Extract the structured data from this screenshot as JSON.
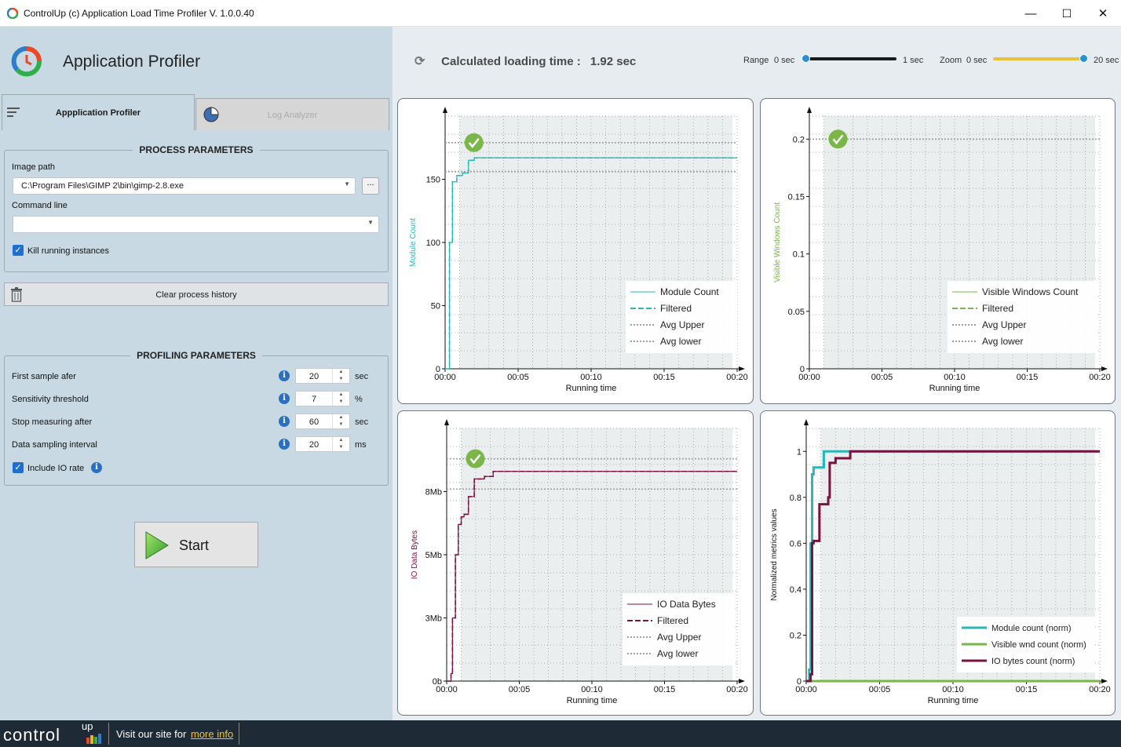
{
  "window": {
    "title": "ControlUp (c) Application Load Time Profiler  V. 1.0.0.40",
    "controls": {
      "minimize": "—",
      "maximize": "☐",
      "close": "✕"
    }
  },
  "header": {
    "app_title": "Application Profiler",
    "calc_label": "Calculated loading time :",
    "calc_value": "1.92 sec",
    "range": {
      "label": "Range",
      "min": "0 sec",
      "max": "1 sec",
      "level": 1.0
    },
    "zoom": {
      "label": "Zoom",
      "min": "0 sec",
      "max": "20 sec",
      "level": 1.0
    }
  },
  "tabs": [
    {
      "label": "Appplication Profiler",
      "active": true
    },
    {
      "label": "Log Analyzer",
      "active": false
    }
  ],
  "process": {
    "title": "PROCESS PARAMETERS",
    "image_path_label": "Image path",
    "image_path_value": "C:\\Program Files\\GIMP 2\\bin\\gimp-2.8.exe",
    "browse_label": "...",
    "cmd_label": "Command line",
    "cmd_value": "",
    "kill_label": "Kill running instances",
    "kill_checked": true
  },
  "clear_label": "Clear process history",
  "profiling": {
    "title": "PROFILING PARAMETERS",
    "rows": [
      {
        "label": "First sample afer",
        "value": "20",
        "unit": "sec"
      },
      {
        "label": "Sensitivity threshold",
        "value": "7",
        "unit": "%"
      },
      {
        "label": "Stop measuring after",
        "value": "60",
        "unit": "sec"
      },
      {
        "label": "Data sampling interval",
        "value": "20",
        "unit": "ms"
      }
    ],
    "io_label": "Include IO rate",
    "io_checked": true
  },
  "start_label": "Start",
  "footer": {
    "brand": "control",
    "brand_up": "up",
    "text": "Visit our site for",
    "link": "more info"
  },
  "colors": {
    "module": "#2ab7b7",
    "visible": "#7ab648",
    "io": "#7a1240",
    "avg": "#a0a0a0",
    "check": "#7ab648",
    "slider_range": "#1a1a1a",
    "slider_zoom": "#e9c23c"
  },
  "chart_data": [
    {
      "type": "line",
      "xlabel": "Running time",
      "ylabel": "Module Count",
      "xticks": [
        "00:00",
        "00:05",
        "00:10",
        "00:15",
        "00:20"
      ],
      "xlim": [
        0,
        20
      ],
      "ylim": [
        0,
        200
      ],
      "yticks": [
        "0",
        "50",
        "100",
        "150"
      ],
      "ytick_values": [
        0,
        50,
        100,
        150
      ],
      "series": [
        {
          "name": "Module Count",
          "style": "solid",
          "color": "#2ab7b7",
          "x": [
            0,
            0.3,
            0.5,
            0.8,
            1.2,
            1.6,
            2.0,
            20
          ],
          "y": [
            0,
            100,
            148,
            153,
            155,
            165,
            167,
            167
          ]
        },
        {
          "name": "Filtered",
          "style": "dashed",
          "color": "#2ab7b7",
          "x": [
            0,
            0.3,
            0.5,
            0.8,
            1.2,
            1.6,
            2.0,
            20
          ],
          "y": [
            0,
            100,
            148,
            153,
            155,
            165,
            167,
            167
          ]
        },
        {
          "name": "Avg Upper",
          "style": "dotted",
          "color": "#a0a0a0",
          "x": [
            0,
            20
          ],
          "y": [
            179,
            179
          ]
        },
        {
          "name": "Avg lower",
          "style": "dotted",
          "color": "#a0a0a0",
          "x": [
            0,
            20
          ],
          "y": [
            156,
            156
          ]
        }
      ],
      "check_x": 1.92
    },
    {
      "type": "line",
      "xlabel": "Running time",
      "ylabel": "Visible Windows Count",
      "xticks": [
        "00:00",
        "00:05",
        "00:10",
        "00:15",
        "00:20"
      ],
      "xlim": [
        0,
        20
      ],
      "ylim": [
        0,
        0.22
      ],
      "yticks": [
        "0",
        "0.05",
        "0.1",
        "0.15",
        "0.2"
      ],
      "ytick_values": [
        0,
        0.05,
        0.1,
        0.15,
        0.2
      ],
      "series": [
        {
          "name": "Visible Windows Count",
          "style": "solid",
          "color": "#7ab648",
          "x": [],
          "y": []
        },
        {
          "name": "Filtered",
          "style": "dashed",
          "color": "#7ab648",
          "x": [],
          "y": []
        },
        {
          "name": "Avg Upper",
          "style": "dotted",
          "color": "#a0a0a0",
          "x": [
            0,
            20
          ],
          "y": [
            0.2,
            0.2
          ]
        },
        {
          "name": "Avg lower",
          "style": "dotted",
          "color": "#a0a0a0",
          "x": [
            0,
            20
          ],
          "y": [
            0.2,
            0.2
          ]
        }
      ],
      "check_x": 1.92
    },
    {
      "type": "line",
      "xlabel": "Running time",
      "ylabel": "IO Data Bytes",
      "xticks": [
        "00:00",
        "00:05",
        "00:10",
        "00:15",
        "00:20"
      ],
      "xlim": [
        0,
        20
      ],
      "ylim": [
        0,
        10
      ],
      "yticks": [
        "0b",
        "3Mb",
        "5Mb",
        "8Mb"
      ],
      "ytick_values": [
        0,
        2.5,
        5,
        7.5
      ],
      "series": [
        {
          "name": "IO Data Bytes",
          "style": "solid",
          "color": "#7a1240",
          "x": [
            0,
            0.3,
            0.4,
            0.6,
            0.8,
            1.0,
            1.2,
            1.5,
            1.9,
            2.6,
            3.2,
            20
          ],
          "y": [
            0,
            0.3,
            2.5,
            5.0,
            6.2,
            6.5,
            6.6,
            7.3,
            8.0,
            8.1,
            8.3,
            8.3
          ]
        },
        {
          "name": "Filtered",
          "style": "dashed",
          "color": "#7a1240",
          "x": [
            0,
            0.3,
            0.4,
            0.6,
            0.8,
            1.0,
            1.2,
            1.5,
            1.9,
            2.6,
            3.2,
            20
          ],
          "y": [
            0,
            0.3,
            2.5,
            5.0,
            6.2,
            6.5,
            6.6,
            7.3,
            8.0,
            8.1,
            8.3,
            8.3
          ]
        },
        {
          "name": "Avg Upper",
          "style": "dotted",
          "color": "#a0a0a0",
          "x": [
            0,
            20
          ],
          "y": [
            8.8,
            8.8
          ]
        },
        {
          "name": "Avg lower",
          "style": "dotted",
          "color": "#a0a0a0",
          "x": [
            0,
            20
          ],
          "y": [
            7.6,
            7.6
          ]
        }
      ],
      "check_x": 1.92
    },
    {
      "type": "line",
      "xlabel": "Running time",
      "ylabel": "Normalized metrics values",
      "xticks": [
        "00:00",
        "00:05",
        "00:10",
        "00:15",
        "00:20"
      ],
      "xlim": [
        0,
        20
      ],
      "ylim": [
        0,
        1.1
      ],
      "yticks": [
        "0",
        "0.2",
        "0.4",
        "0.6",
        "0.8",
        "1"
      ],
      "ytick_values": [
        0,
        0.2,
        0.4,
        0.6,
        0.8,
        1
      ],
      "series": [
        {
          "name": "Module count (norm)",
          "style": "solid",
          "color": "#2ab7b7",
          "x": [
            0,
            0.2,
            0.3,
            0.4,
            0.5,
            1.0,
            1.2,
            20
          ],
          "y": [
            0,
            0.05,
            0.6,
            0.9,
            0.93,
            0.93,
            1,
            1
          ]
        },
        {
          "name": "Visible wnd count (norm)",
          "style": "solid",
          "color": "#7ab648",
          "x": [
            0,
            20
          ],
          "y": [
            0,
            0
          ]
        },
        {
          "name": "IO bytes count (norm)",
          "style": "solid",
          "color": "#7a1240",
          "x": [
            0,
            0.3,
            0.4,
            0.5,
            0.8,
            0.9,
            1.5,
            1.6,
            2.0,
            2.6,
            3.0,
            20
          ],
          "y": [
            0,
            0.03,
            0.6,
            0.61,
            0.61,
            0.77,
            0.8,
            0.95,
            0.97,
            0.97,
            1,
            1
          ]
        }
      ]
    }
  ]
}
